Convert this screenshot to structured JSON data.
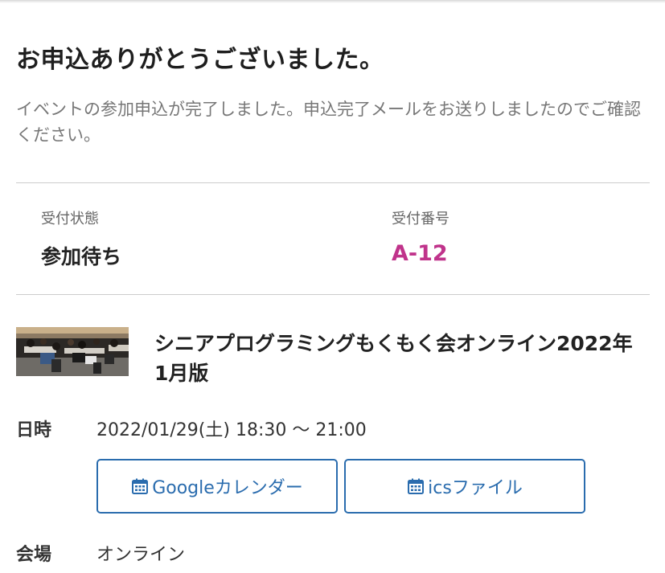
{
  "confirmation": {
    "title": "お申込ありがとうございました。",
    "message": "イベントの参加申込が完了しました。申込完了メールをお送りしましたのでご確認ください。"
  },
  "reception": {
    "status_label": "受付状態",
    "status_value": "参加待ち",
    "number_label": "受付番号",
    "number_value": "A-12",
    "number_color": "#c0338b"
  },
  "event": {
    "title": "シニアプログラミングもくもく会オンライン2022年1月版",
    "thumbnail_icon": "event-photo",
    "datetime_label": "日時",
    "datetime_value": "2022/01/29(土) 18:30 〜 21:00",
    "venue_label": "会場",
    "venue_value": "オンライン"
  },
  "calendar": {
    "google_label": "Googleカレンダー",
    "ics_label": "icsファイル",
    "icon": "calendar-icon",
    "accent_color": "#2a6cae"
  }
}
